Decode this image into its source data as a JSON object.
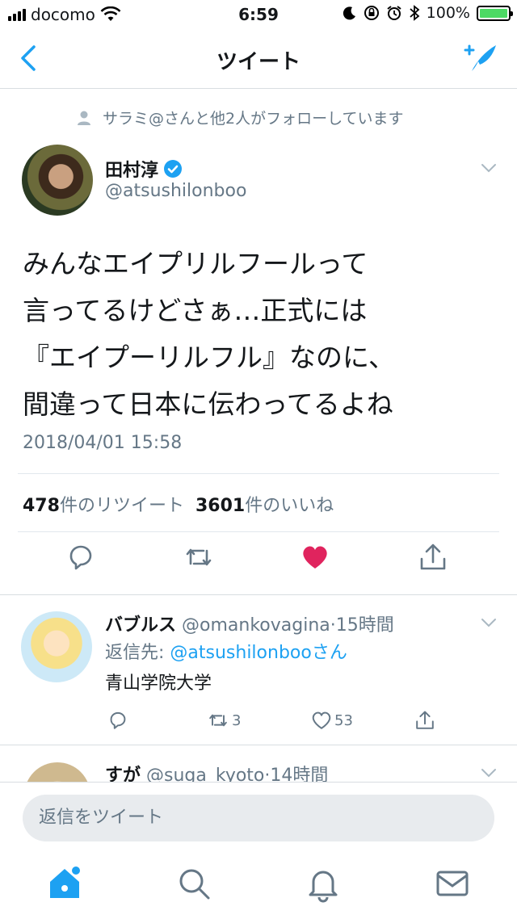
{
  "status_bar": {
    "carrier": "docomo",
    "time": "6:59",
    "battery": "100%"
  },
  "nav": {
    "title": "ツイート"
  },
  "context": {
    "text": "サラミ@さんと他2人がフォローしています"
  },
  "tweet": {
    "name": "田村淳",
    "handle": "@atsushilonboo",
    "lines": [
      "みんなエイプリルフールって",
      "言ってるけどさぁ…正式には",
      "『エイプーリルフル』なのに、",
      "間違って日本に伝わってるよね"
    ],
    "timestamp": "2018/04/01 15:58",
    "retweet_count": "478",
    "retweet_label": "件のリツイート",
    "like_count": "3601",
    "like_label": "件のいいね"
  },
  "reply": {
    "name": "バブルス",
    "handle": "@omankovagina",
    "time": "·15時間",
    "reply_prefix": "返信先: ",
    "reply_target": "@atsushilonbooさん",
    "text": "青山学院大学",
    "retweets": "3",
    "likes": "53"
  },
  "reply2": {
    "name": "すが",
    "handle": "@suga_kyoto",
    "time": "·14時間"
  },
  "composer": {
    "placeholder": "返信をツイート"
  },
  "colors": {
    "accent": "#1da1f2",
    "like": "#e0245e",
    "muted": "#657786"
  }
}
